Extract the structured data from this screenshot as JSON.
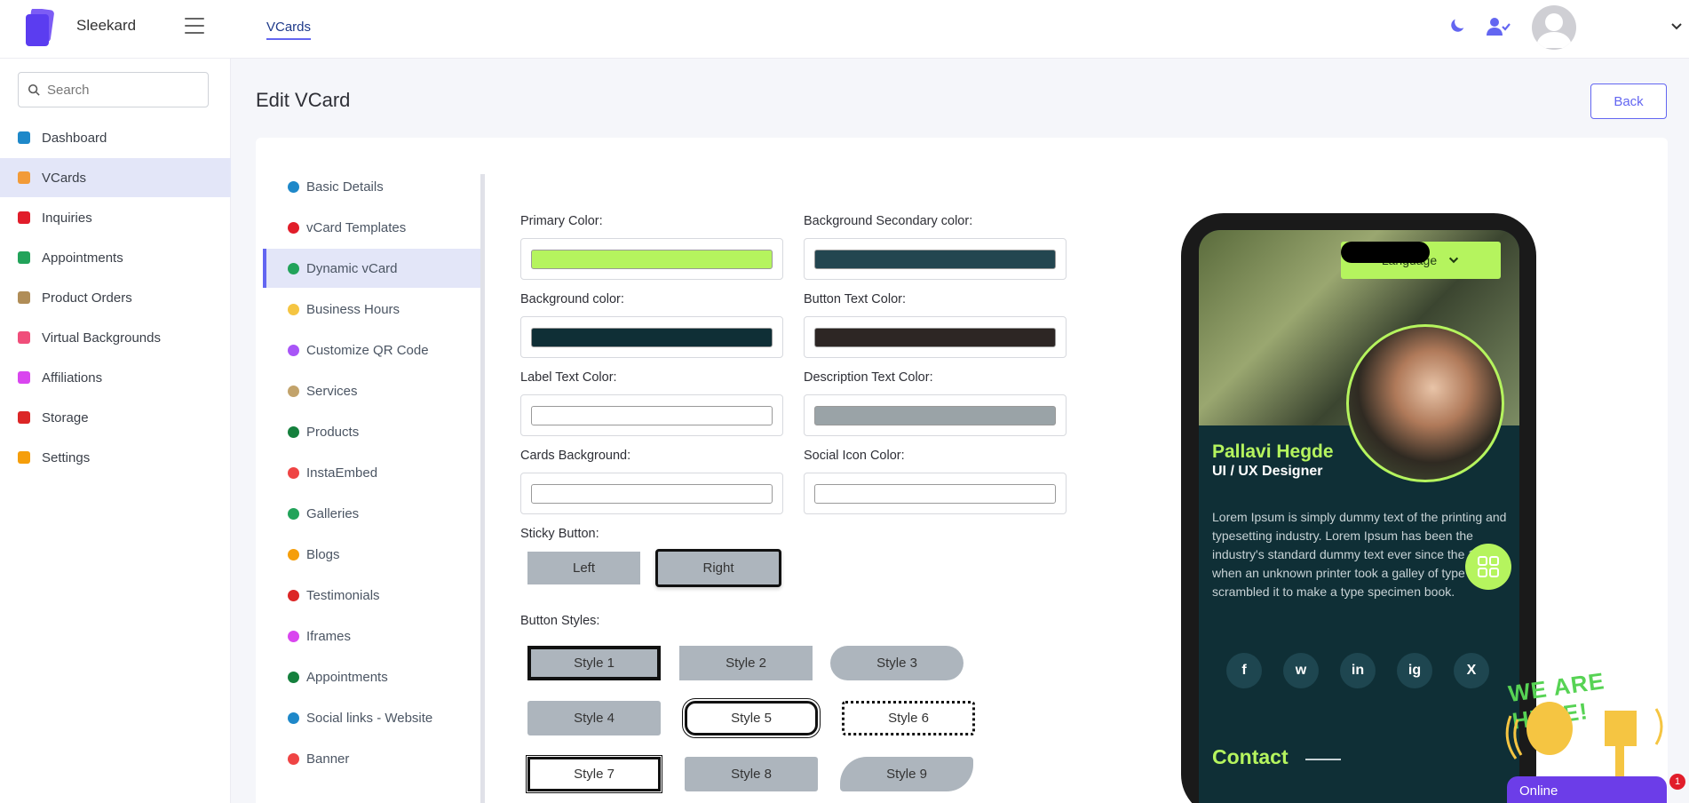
{
  "app": {
    "brand": "Sleekard"
  },
  "topbar": {
    "active_tab": "VCards"
  },
  "sidebar": {
    "search_placeholder": "Search",
    "items": [
      {
        "label": "Dashboard",
        "icon": "dashboard-icon",
        "color": "#1e88c9"
      },
      {
        "label": "VCards",
        "icon": "vcard-icon",
        "color": "#f29b38",
        "active": true
      },
      {
        "label": "Inquiries",
        "icon": "info-icon",
        "color": "#e11d2a"
      },
      {
        "label": "Appointments",
        "icon": "calendar-icon",
        "color": "#22a35a"
      },
      {
        "label": "Product Orders",
        "icon": "cash-icon",
        "color": "#b08d57"
      },
      {
        "label": "Virtual Backgrounds",
        "icon": "image-icon",
        "color": "#f04e7a"
      },
      {
        "label": "Affiliations",
        "icon": "stack-icon",
        "color": "#d946ef"
      },
      {
        "label": "Storage",
        "icon": "storage-icon",
        "color": "#dc2626"
      },
      {
        "label": "Settings",
        "icon": "gear-icon",
        "color": "#f59e0b"
      }
    ]
  },
  "main": {
    "title": "Edit VCard",
    "back_label": "Back"
  },
  "inner_nav": [
    {
      "label": "Basic Details",
      "icon": "question-icon",
      "color": "#1e88c9"
    },
    {
      "label": "vCard Templates",
      "icon": "template-icon",
      "color": "#e11d2a"
    },
    {
      "label": "Dynamic vCard",
      "icon": "dynamic-icon",
      "color": "#22a35a",
      "active": true
    },
    {
      "label": "Business Hours",
      "icon": "clock-icon",
      "color": "#f5c542"
    },
    {
      "label": "Customize QR Code",
      "icon": "qr-icon",
      "color": "#a855f7"
    },
    {
      "label": "Services",
      "icon": "wrench-icon",
      "color": "#c2a36b"
    },
    {
      "label": "Products",
      "icon": "product-icon",
      "color": "#15803d"
    },
    {
      "label": "InstaEmbed",
      "icon": "insta-icon",
      "color": "#ef4444"
    },
    {
      "label": "Galleries",
      "icon": "gallery-icon",
      "color": "#22a35a"
    },
    {
      "label": "Blogs",
      "icon": "rss-icon",
      "color": "#f59e0b"
    },
    {
      "label": "Testimonials",
      "icon": "chat-icon",
      "color": "#dc2626"
    },
    {
      "label": "Iframes",
      "icon": "crop-icon",
      "color": "#d946ef"
    },
    {
      "label": "Appointments",
      "icon": "calendar-icon",
      "color": "#15803d"
    },
    {
      "label": "Social links - Website",
      "icon": "globe-icon",
      "color": "#1e88c9"
    },
    {
      "label": "Banner",
      "icon": "banner-icon",
      "color": "#ef4444"
    }
  ],
  "colors": [
    {
      "label": "Primary Color:",
      "value": "#b5f45e"
    },
    {
      "label": "Background Secondary color:",
      "value": "#234650"
    },
    {
      "label": "Background color:",
      "value": "#0f2f36"
    },
    {
      "label": "Button Text Color:",
      "value": "#2d2624"
    },
    {
      "label": "Label Text Color:",
      "value": "#ffffff"
    },
    {
      "label": "Description Text Color:",
      "value": "#9aa3a7"
    },
    {
      "label": "Cards Background:",
      "value": "#ffffff"
    },
    {
      "label": "Social Icon Color:",
      "value": "#ffffff"
    }
  ],
  "sticky": {
    "label": "Sticky Button:",
    "left": "Left",
    "right": "Right",
    "selected": "Right"
  },
  "button_styles": {
    "label": "Button Styles:",
    "items": [
      "Style 1",
      "Style 2",
      "Style 3",
      "Style 4",
      "Style 5",
      "Style 6",
      "Style 7",
      "Style 8",
      "Style 9"
    ],
    "selected": "Style 1"
  },
  "preview": {
    "language": "Language",
    "name": "Pallavi Hegde",
    "role": "UI / UX Designer",
    "description": "Lorem Ipsum is simply dummy text of the printing and typesetting industry. Lorem Ipsum has been the industry's standard dummy text ever since the 1500s, when an unknown printer took a galley of type and scrambled it to make a type specimen book.",
    "social": [
      "f",
      "w",
      "in",
      "ig",
      "X"
    ],
    "contact": "Contact"
  },
  "widget": {
    "tagline": "WE ARE HERE!",
    "status": "Online",
    "badge": "1"
  }
}
